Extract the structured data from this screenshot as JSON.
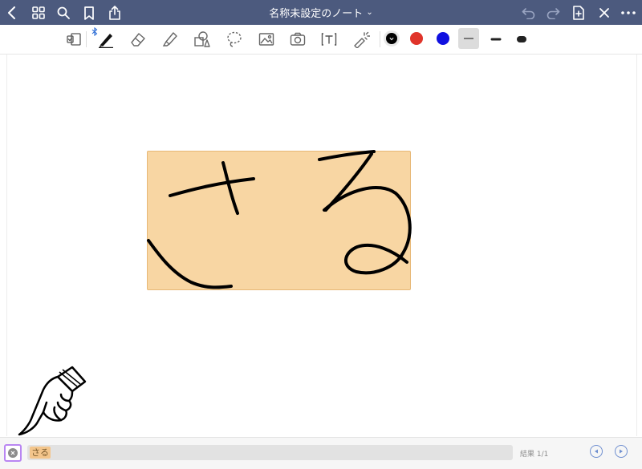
{
  "app": {
    "title": "名称未設定のノート",
    "title_chevron": "⌄"
  },
  "topbar_icons": [
    "chevron-left-icon",
    "grid-icon",
    "search-icon",
    "bookmark-icon",
    "share-icon",
    "undo-icon",
    "redo-icon",
    "add-page-icon",
    "close-icon",
    "more-icon"
  ],
  "tools": [
    "page-view-icon",
    "bluetooth-icon",
    "pen-icon",
    "eraser-icon",
    "highlighter-icon",
    "shapes-icon",
    "lasso-icon",
    "image-icon",
    "camera-icon",
    "text-icon",
    "laser-pointer-icon"
  ],
  "colors": {
    "topbar": "#4c5a7e",
    "swatch_black": "#000000",
    "swatch_red": "#e0342a",
    "swatch_blue": "#1010e0",
    "highlight": "#f8d6a3",
    "search_highlight": "#f3c58b",
    "focus_outline": "#b986f2"
  },
  "note": {
    "handwriting": "さる"
  },
  "search": {
    "query": "さる",
    "result_label": "結果 1/1"
  }
}
